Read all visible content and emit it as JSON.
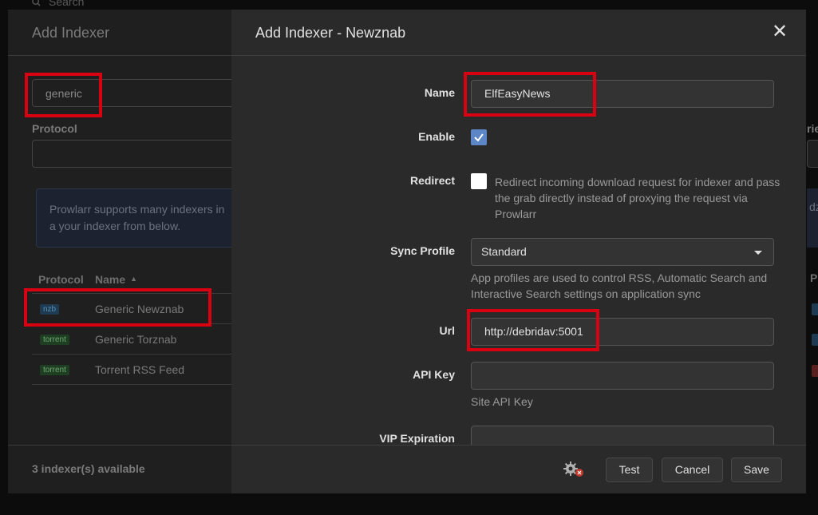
{
  "top": {
    "search_placeholder": "Search"
  },
  "background_modal": {
    "title": "Add Indexer",
    "search_value": "generic",
    "protocol_label": "Protocol",
    "info_text": "Prowlarr supports many indexers in a your indexer from below.",
    "table": {
      "headers": [
        "Protocol",
        "Name"
      ],
      "rows": [
        {
          "protocol": "nzb",
          "name": "Generic Newznab"
        },
        {
          "protocol": "torrent",
          "name": "Generic Torznab"
        },
        {
          "protocol": "torrent",
          "name": "Torrent RSS Feed"
        }
      ]
    },
    "count_text": "3 indexer(s) available",
    "right_partial": {
      "label": "rie",
      "info": "dz",
      "head": "P"
    }
  },
  "modal": {
    "title": "Add Indexer - Newznab",
    "fields": {
      "name": {
        "label": "Name",
        "value": "ElfEasyNews"
      },
      "enable": {
        "label": "Enable",
        "checked": true
      },
      "redirect": {
        "label": "Redirect",
        "checked": false,
        "help": "Redirect incoming download request for indexer and pass the grab directly instead of proxying the request via Prowlarr"
      },
      "sync_profile": {
        "label": "Sync Profile",
        "value": "Standard",
        "help": "App profiles are used to control RSS, Automatic Search and Interactive Search settings on application sync"
      },
      "url": {
        "label": "Url",
        "value": "http://debridav:5001"
      },
      "api_key": {
        "label": "API Key",
        "value": "",
        "help": "Site API Key"
      },
      "vip_expiration": {
        "label": "VIP Expiration",
        "value": ""
      }
    },
    "footer": {
      "test": "Test",
      "cancel": "Cancel",
      "save": "Save"
    }
  },
  "colors": {
    "accent_checkbox": "#5c86c6",
    "annotation_red": "#d90012",
    "nzb_badge": "#1e3b52",
    "torrent_badge": "#1e3f22"
  },
  "icons": [
    "search-icon",
    "close-icon",
    "check-icon",
    "caret-down-icon",
    "gear-icon",
    "error-badge-icon",
    "sort-asc-icon"
  ]
}
